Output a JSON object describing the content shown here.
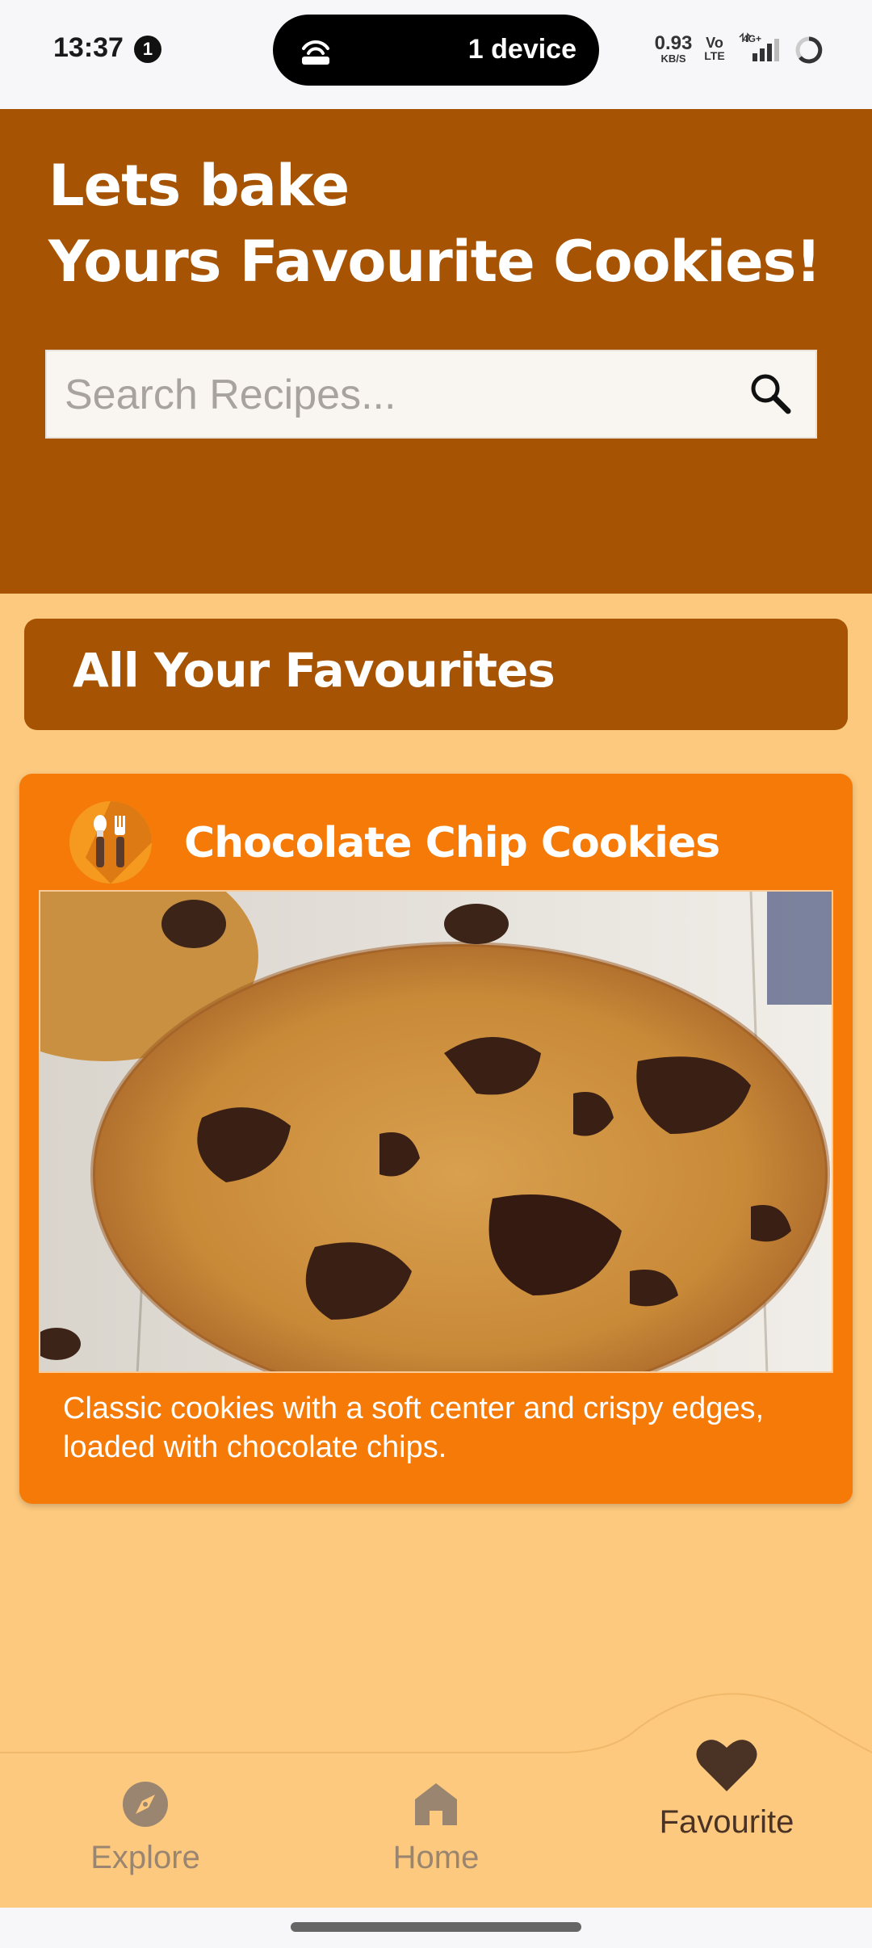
{
  "status_bar": {
    "time": "13:37",
    "notification_count": "1",
    "hotspot_text": "1 device",
    "net_speed_value": "0.93",
    "net_speed_unit": "KB/S",
    "volte_top": "Vo",
    "volte_bottom": "LTE",
    "network_type": "4G+"
  },
  "header": {
    "title_line1": "Lets bake",
    "title_line2": "Yours Favourite Cookies!",
    "search_placeholder": "Search Recipes...",
    "search_value": ""
  },
  "favourites": {
    "section_title": "All Your Favourites",
    "items": [
      {
        "title": "Chocolate Chip Cookies",
        "description": "Classic cookies with a soft center and crispy edges, loaded with chocolate chips.",
        "logo_icon": "utensils-logo-icon",
        "image": "chocolate-chip-cookie-photo"
      }
    ]
  },
  "bottom_nav": {
    "items": [
      {
        "label": "Explore",
        "icon": "compass-icon",
        "active": false
      },
      {
        "label": "Home",
        "icon": "home-icon",
        "active": false
      },
      {
        "label": "Favourite",
        "icon": "heart-icon",
        "active": true
      }
    ]
  },
  "colors": {
    "header_bg": "#a65404",
    "page_bg": "#fdc97e",
    "card_bg": "#f57a07",
    "nav_active": "#4a3324",
    "nav_inactive": "#9a8670"
  }
}
